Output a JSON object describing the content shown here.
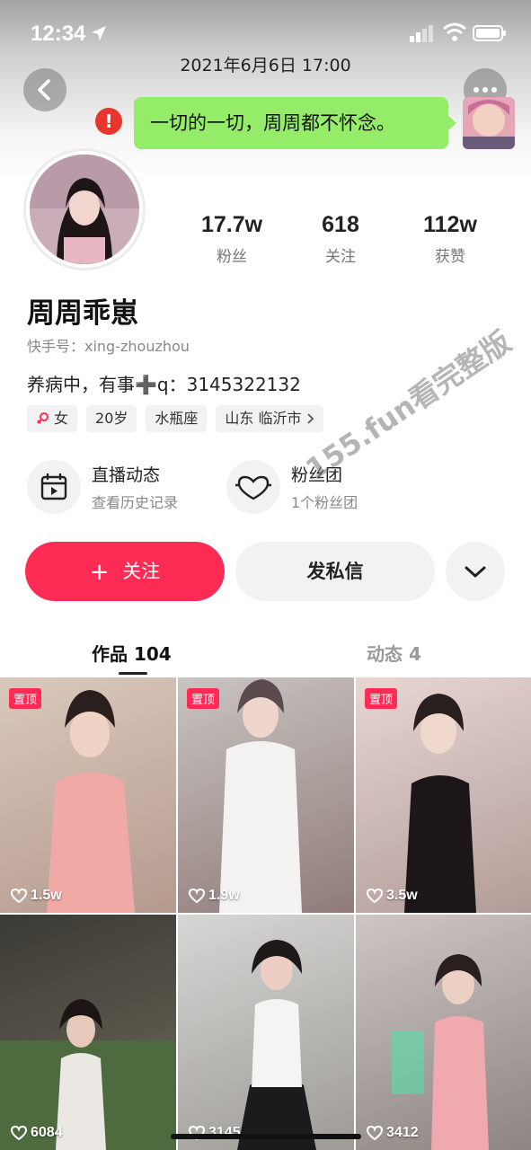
{
  "status_bar": {
    "time": "12:34"
  },
  "header": {
    "date": "2021年6月6日 17:00"
  },
  "chat": {
    "message": "一切的一切，周周都不怀念。",
    "error_mark": "!"
  },
  "profile": {
    "stats": [
      {
        "value": "17.7w",
        "label": "粉丝"
      },
      {
        "value": "618",
        "label": "关注"
      },
      {
        "value": "112w",
        "label": "获赞"
      }
    ],
    "name": "周周乖崽",
    "kuaishou_id": "快手号：xing-zhouzhou",
    "bio": "养病中，有事➕q：3145322132",
    "tags": {
      "gender": "女",
      "age": "20岁",
      "zodiac": "水瓶座",
      "location": "山东 临沂市"
    }
  },
  "features": {
    "live": {
      "title": "直播动态",
      "subtitle": "查看历史记录"
    },
    "fans": {
      "title": "粉丝团",
      "subtitle": "1个粉丝团"
    }
  },
  "actions": {
    "follow": "关注",
    "message": "发私信"
  },
  "tabs": {
    "works": "作品 104",
    "moments": "动态 4"
  },
  "videos": [
    {
      "likes": "1.5w",
      "pinned": "置顶"
    },
    {
      "likes": "1.9w",
      "pinned": "置顶"
    },
    {
      "likes": "3.5w",
      "pinned": "置顶"
    },
    {
      "likes": "6084"
    },
    {
      "likes": "3145"
    },
    {
      "likes": "3412"
    }
  ],
  "watermark": "155.fun看完整版",
  "colors": {
    "accent": "#fe2c55",
    "chat_bubble": "#95ec69",
    "error": "#e8352e"
  }
}
